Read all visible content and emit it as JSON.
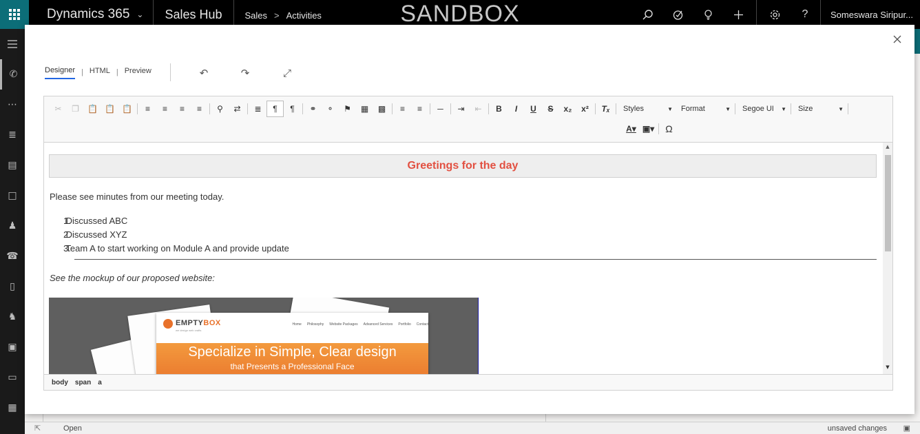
{
  "topbar": {
    "app_name": "Dynamics 365",
    "module": "Sales Hub",
    "breadcrumb": [
      "Sales",
      "Activities"
    ],
    "environment": "SANDBOX",
    "user": "Someswara Siripur..."
  },
  "editor_modes": [
    "Designer",
    "HTML",
    "Preview"
  ],
  "toolbar": {
    "styles_label": "Styles",
    "format_label": "Format",
    "font_label": "Segoe UI",
    "size_label": "Size"
  },
  "content": {
    "greeting": "Greetings for the day",
    "intro": "Please see minutes from our meeting today.",
    "minutes": [
      "Discussed ABC",
      "Discussed XYZ",
      "Team A to start working on Module A and provide update"
    ],
    "mockup_caption": "See the mockup of our proposed website:",
    "mockup": {
      "logo_a": "EMPTY",
      "logo_b": "BOX",
      "tagline": "we design web crafts",
      "nav": [
        "Home",
        "Philosophy",
        "Website Packages",
        "Advanced Services",
        "Portfolio",
        "Contact"
      ],
      "hero_title": "Specialize in Simple, Clear design",
      "hero_sub": "that Presents a Professional Face"
    }
  },
  "elements_path": [
    "body",
    "span",
    "a"
  ],
  "statusbar": {
    "status": "Open",
    "unsaved": "unsaved changes"
  },
  "colors": {
    "greeting_text": "#e25041",
    "accent_tab": "#2266e3",
    "nav_teal": "#0c6e78",
    "hero_orange": "#e8712a"
  }
}
